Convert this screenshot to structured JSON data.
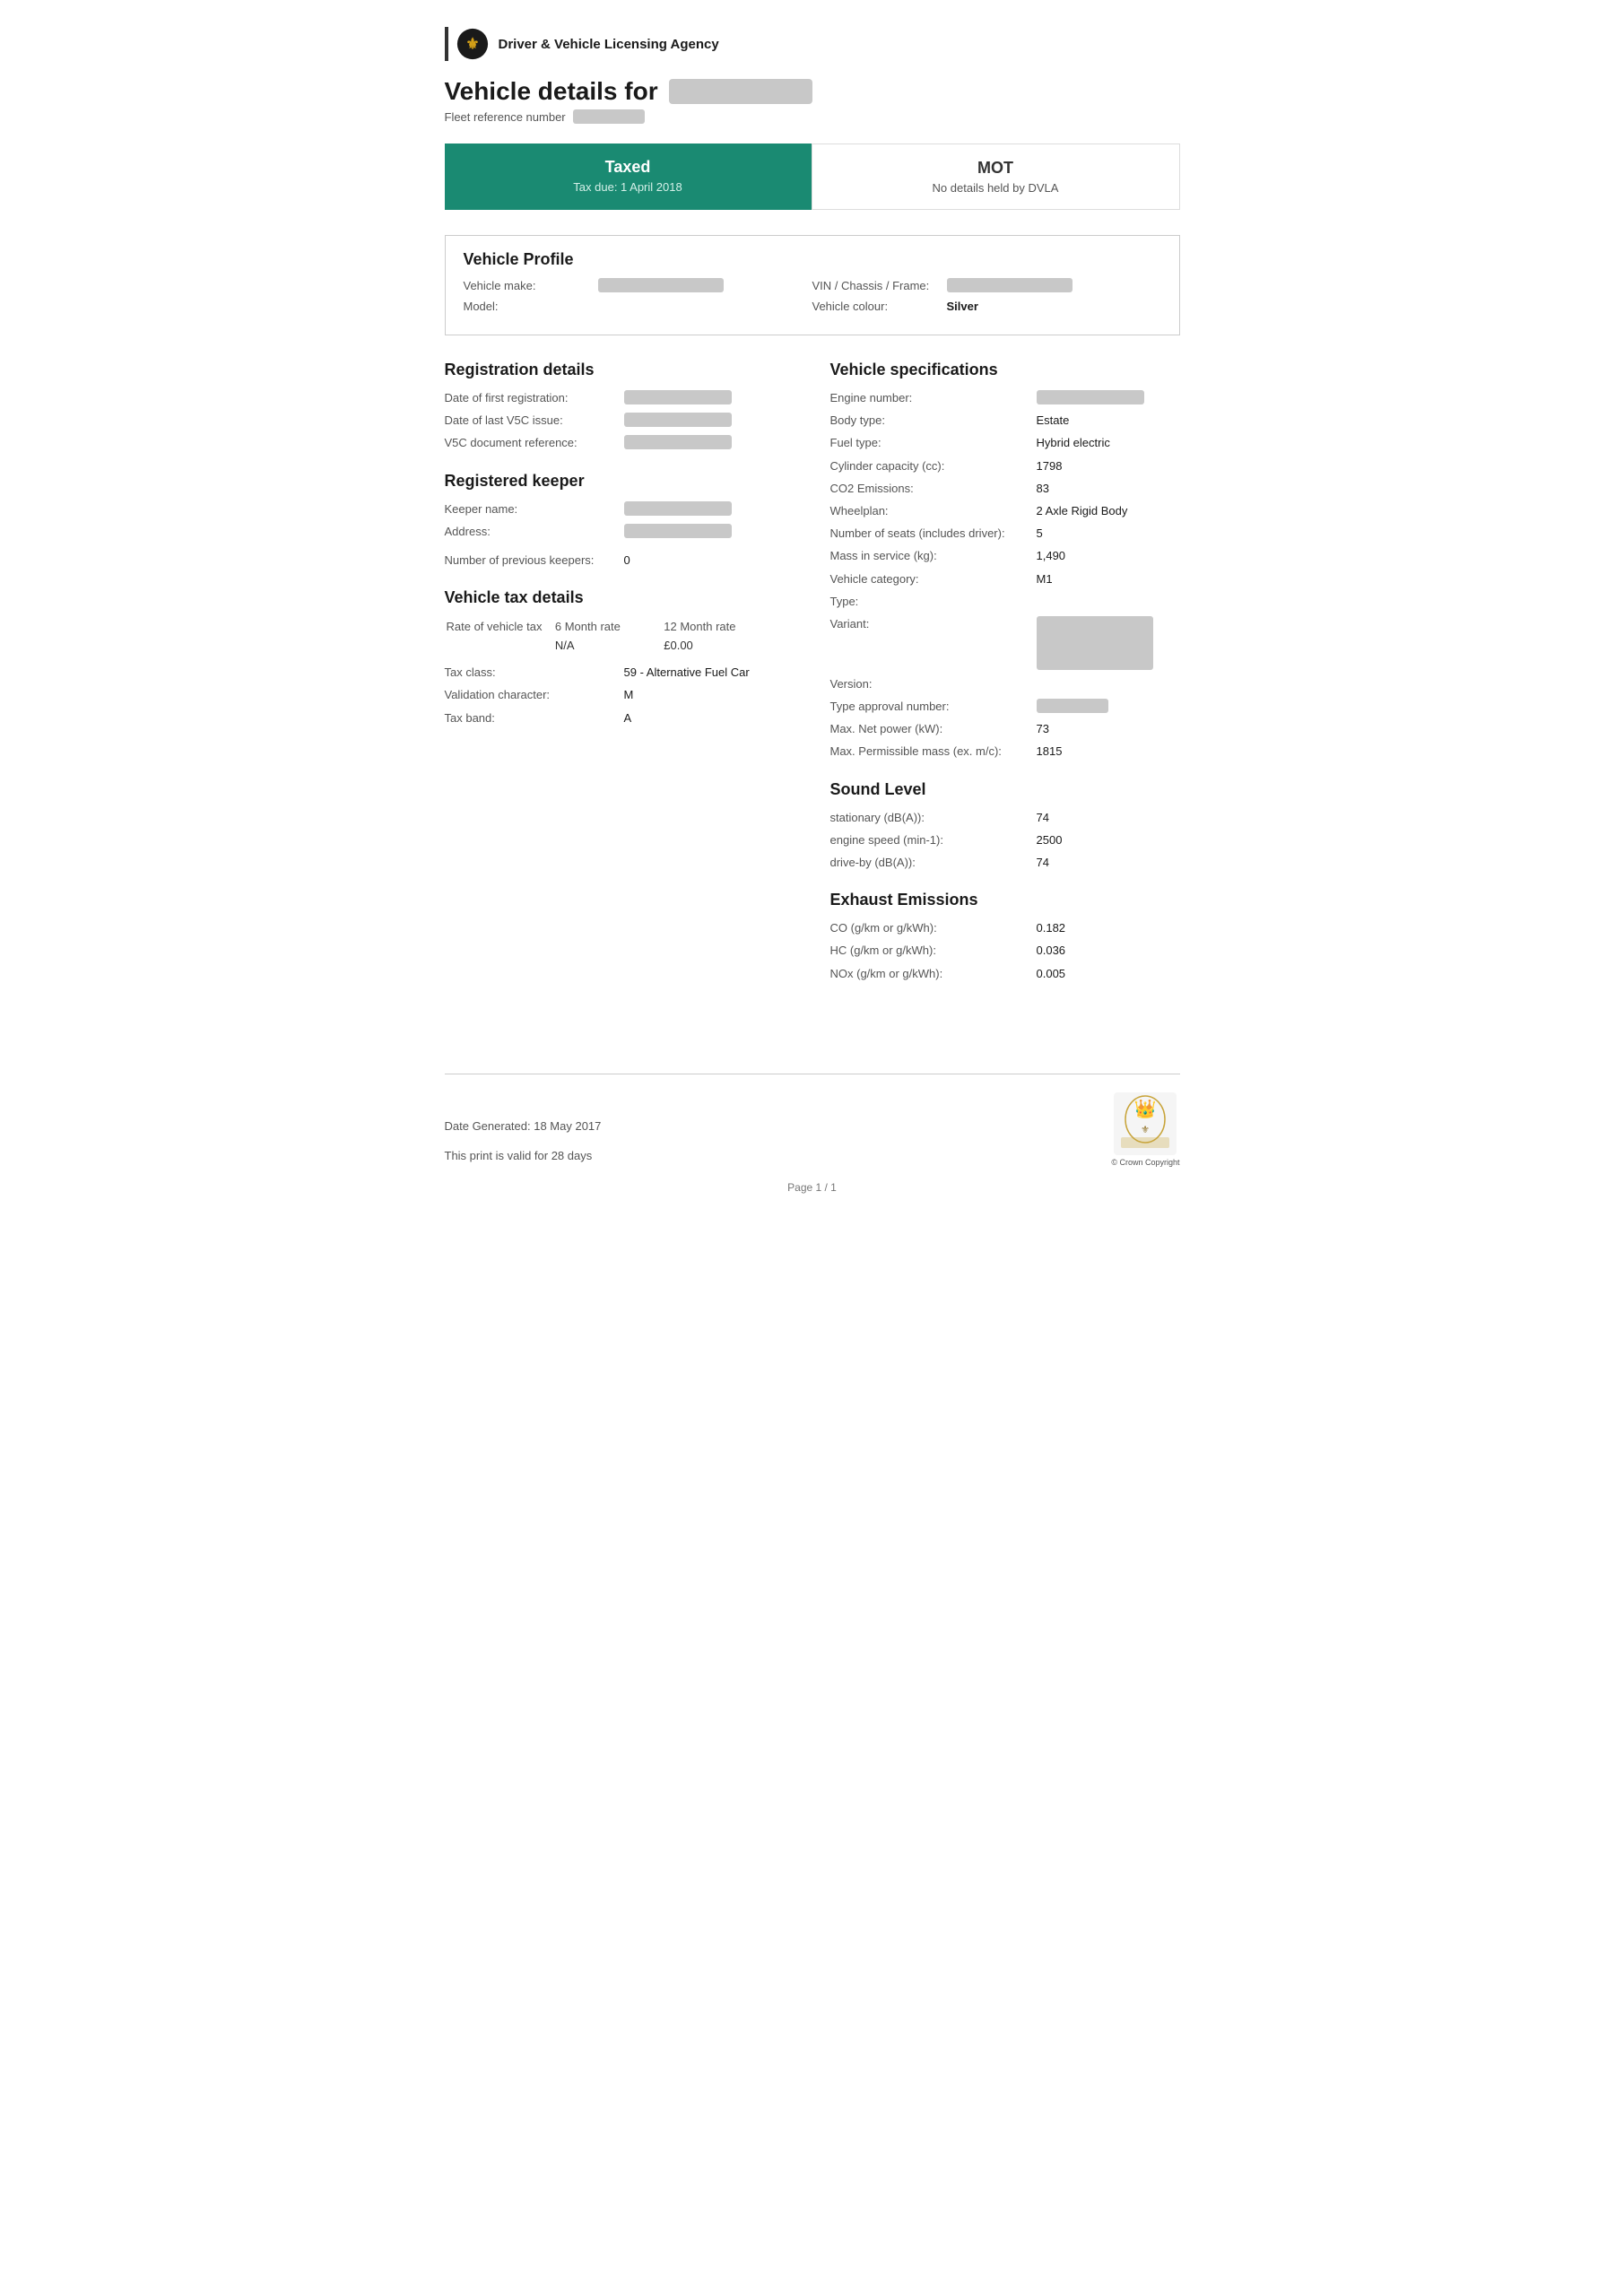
{
  "header": {
    "org_name": "Driver & Vehicle Licensing Agency"
  },
  "page_title": "Vehicle details for",
  "fleet_ref_label": "Fleet reference number",
  "status": {
    "tax_title": "Taxed",
    "tax_due": "Tax due: 1 April 2018",
    "mot_title": "MOT",
    "mot_sub": "No details held by DVLA"
  },
  "vehicle_profile": {
    "title": "Vehicle Profile",
    "make_label": "Vehicle make:",
    "model_label": "Model:",
    "vin_label": "VIN / Chassis / Frame:",
    "colour_label": "Vehicle colour:",
    "colour_value": "Silver"
  },
  "registration": {
    "title": "Registration details",
    "first_reg_label": "Date of first registration:",
    "last_v5c_label": "Date of last V5C issue:",
    "v5c_ref_label": "V5C document reference:"
  },
  "registered_keeper": {
    "title": "Registered keeper",
    "name_label": "Keeper name:",
    "address_label": "Address:",
    "prev_keepers_label": "Number of previous keepers:",
    "prev_keepers_value": "0"
  },
  "vehicle_tax": {
    "title": "Vehicle tax details",
    "rate_label": "Rate of vehicle tax",
    "six_month_header": "6 Month rate",
    "twelve_month_header": "12 Month rate",
    "six_month_value": "N/A",
    "twelve_month_value": "£0.00",
    "tax_class_label": "Tax class:",
    "tax_class_value": "59 - Alternative Fuel Car",
    "validation_char_label": "Validation character:",
    "validation_char_value": "M",
    "tax_band_label": "Tax band:",
    "tax_band_value": "A"
  },
  "vehicle_specs": {
    "title": "Vehicle specifications",
    "engine_number_label": "Engine number:",
    "body_type_label": "Body type:",
    "body_type_value": "Estate",
    "fuel_type_label": "Fuel type:",
    "fuel_type_value": "Hybrid electric",
    "cylinder_label": "Cylinder capacity (cc):",
    "cylinder_value": "1798",
    "co2_label": "CO2 Emissions:",
    "co2_value": "83",
    "wheelplan_label": "Wheelplan:",
    "wheelplan_value": "2 Axle Rigid Body",
    "seats_label": "Number of seats (includes driver):",
    "seats_value": "5",
    "mass_label": "Mass in service (kg):",
    "mass_value": "1,490",
    "category_label": "Vehicle category:",
    "category_value": "M1",
    "type_label": "Type:",
    "variant_label": "Variant:",
    "version_label": "Version:",
    "type_approval_label": "Type approval number:",
    "max_net_power_label": "Max. Net power (kW):",
    "max_net_power_value": "73",
    "max_perm_mass_label": "Max. Permissible mass (ex. m/c):",
    "max_perm_mass_value": "1815"
  },
  "sound_level": {
    "title": "Sound Level",
    "stationary_label": "stationary (dB(A)):",
    "stationary_value": "74",
    "engine_speed_label": "engine speed (min-1):",
    "engine_speed_value": "2500",
    "driveby_label": "drive-by (dB(A)):",
    "driveby_value": "74"
  },
  "exhaust": {
    "title": "Exhaust Emissions",
    "co_label": "CO (g/km or g/kWh):",
    "co_value": "0.182",
    "hc_label": "HC (g/km or g/kWh):",
    "hc_value": "0.036",
    "nox_label": "NOx (g/km or g/kWh):",
    "nox_value": "0.005"
  },
  "footer": {
    "date_generated": "Date Generated: 18 May 2017",
    "validity": "This print is valid for 28 days",
    "crown_copyright": "© Crown Copyright",
    "page": "Page 1 / 1"
  }
}
